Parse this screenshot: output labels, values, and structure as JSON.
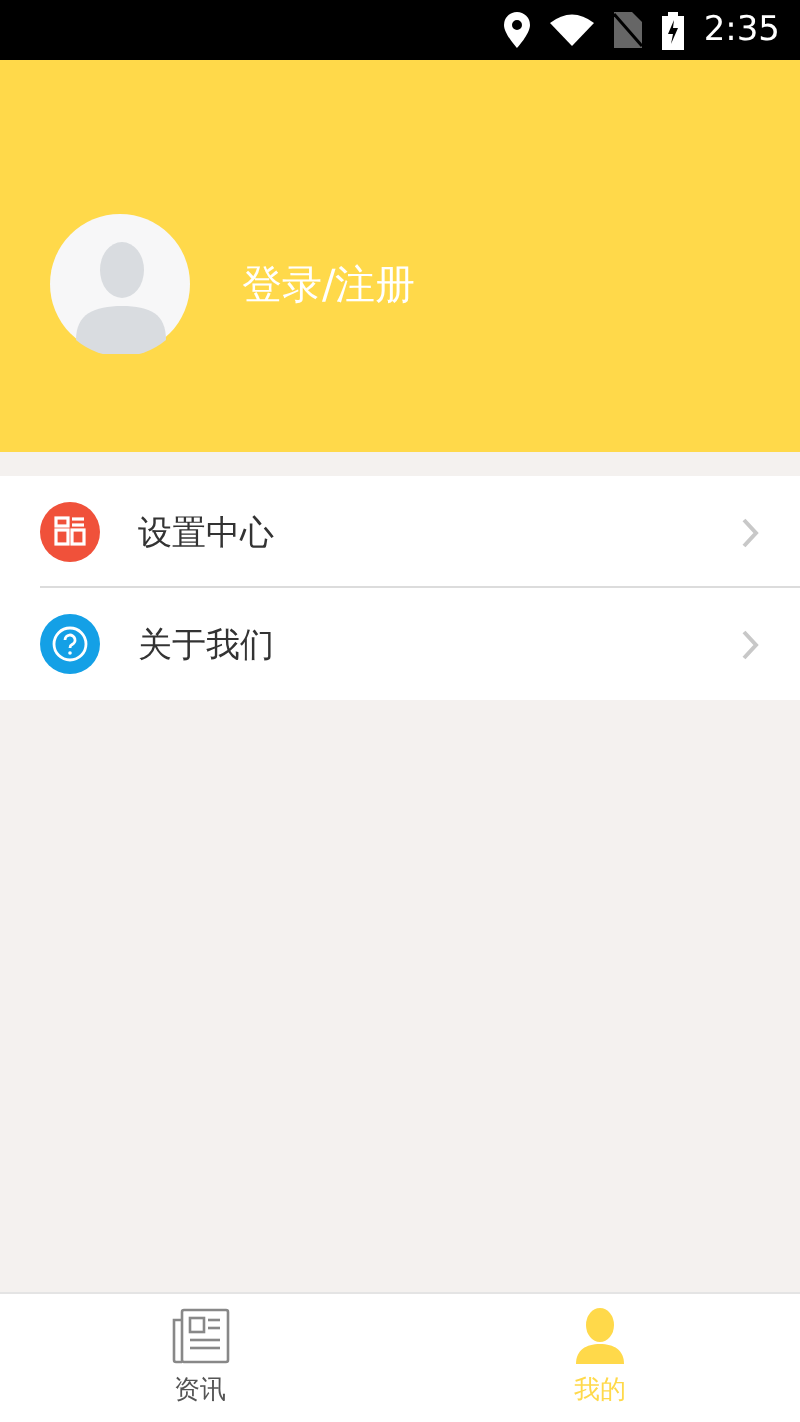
{
  "status_bar": {
    "time": "2:35"
  },
  "profile": {
    "login_label": "登录/注册"
  },
  "menu": [
    {
      "kind": "settings",
      "label": "设置中心"
    },
    {
      "kind": "about",
      "label": "关于我们"
    }
  ],
  "tabs": [
    {
      "kind": "news",
      "label": "资讯",
      "selected": false
    },
    {
      "kind": "me",
      "label": "我的",
      "selected": true
    }
  ]
}
